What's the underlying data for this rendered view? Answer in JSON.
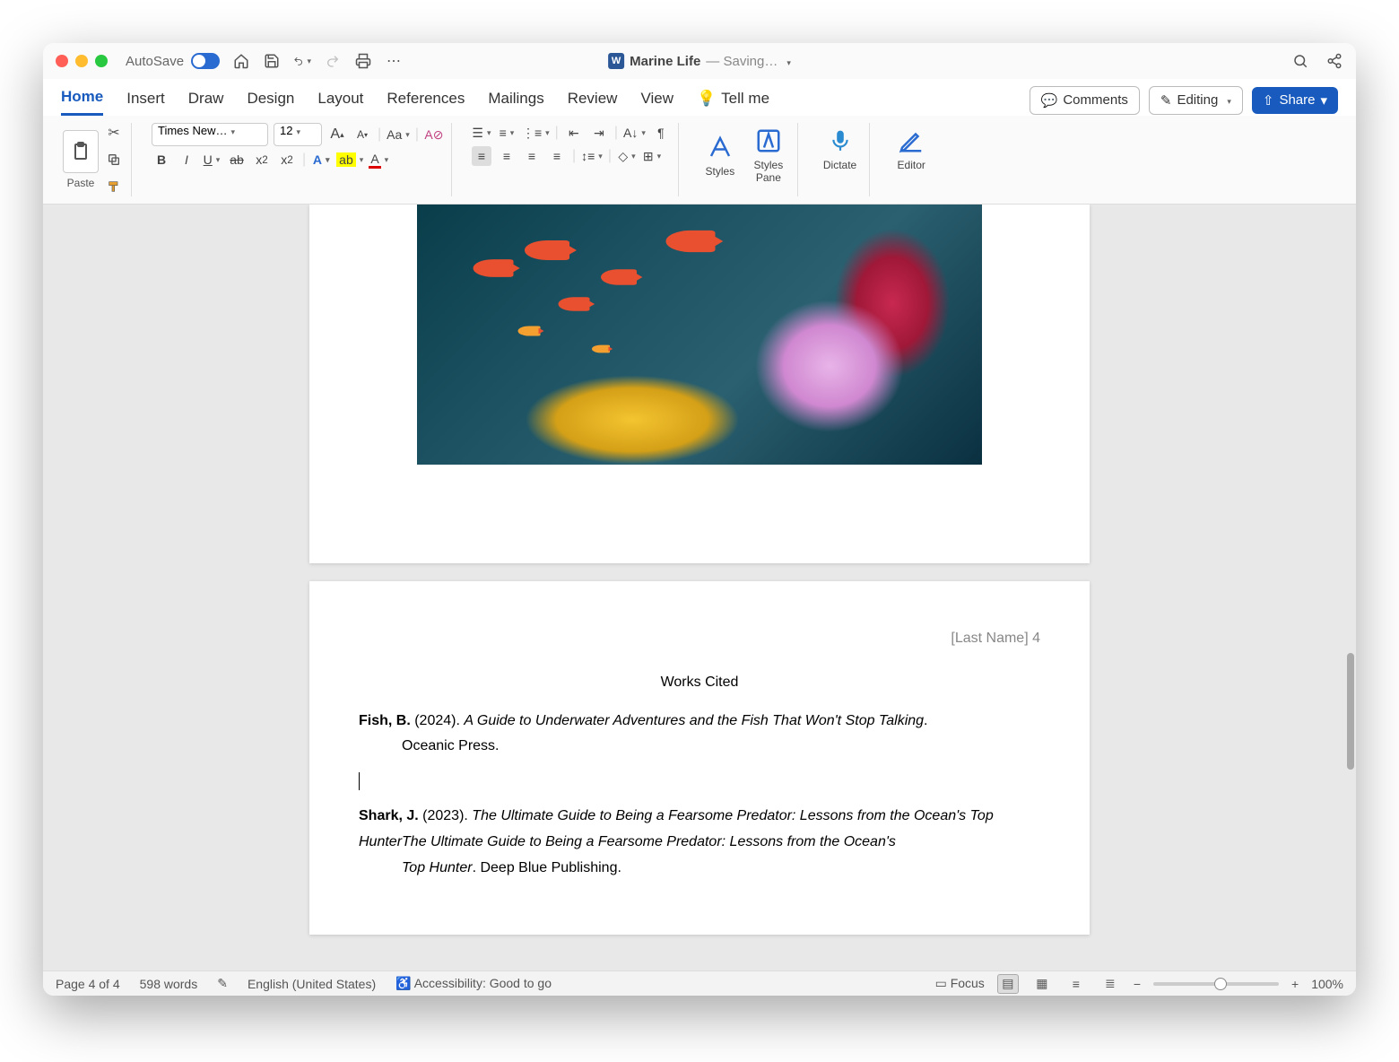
{
  "titlebar": {
    "autosave_label": "AutoSave",
    "doc_name": "Marine Life",
    "saving": "— Saving…"
  },
  "tabs": {
    "items": [
      "Home",
      "Insert",
      "Draw",
      "Design",
      "Layout",
      "References",
      "Mailings",
      "Review",
      "View"
    ],
    "tellme": "Tell me",
    "comments": "Comments",
    "editing": "Editing",
    "share": "Share"
  },
  "ribbon": {
    "paste": "Paste",
    "font_name": "Times New…",
    "font_size": "12",
    "styles": "Styles",
    "styles_pane": "Styles\nPane",
    "dictate": "Dictate",
    "editor": "Editor"
  },
  "document": {
    "header": "[Last Name] 4",
    "title": "Works Cited",
    "cite1": {
      "author": "Fish, B.",
      "year": " (2024). ",
      "title": "A Guide to Underwater Adventures and the Fish That Won't Stop Talking",
      "rest": ". Oceanic Press."
    },
    "cite2": {
      "author": "Shark, J.",
      "year": " (2023). ",
      "title": "The Ultimate Guide to Being a Fearsome Predator: Lessons from the Ocean's Top Hunter",
      "rest": ". Deep Blue Publishing."
    }
  },
  "status": {
    "page": "Page 4 of 4",
    "words": "598 words",
    "lang": "English (United States)",
    "a11y": "Accessibility: Good to go",
    "focus": "Focus",
    "zoom": "100%"
  }
}
